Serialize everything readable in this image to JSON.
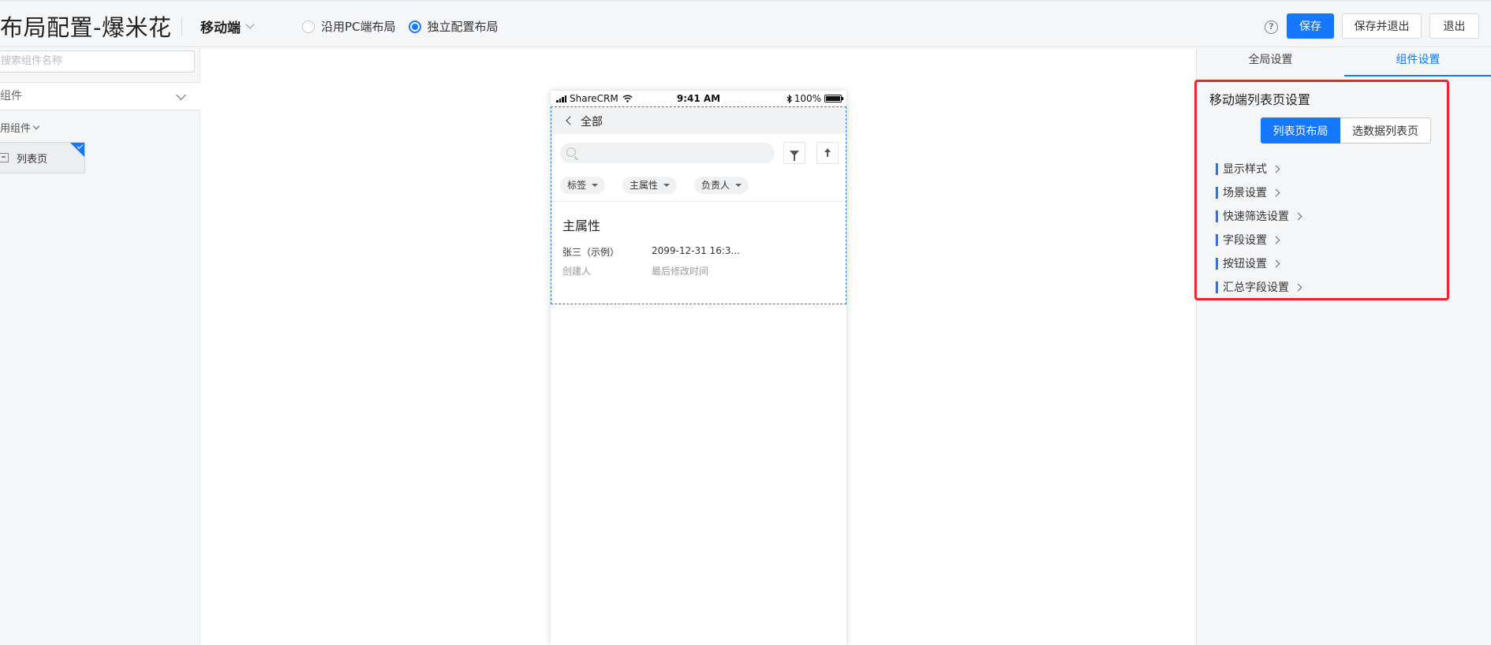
{
  "header": {
    "title": "布局配置-爆米花",
    "platform_label": "移动端",
    "layout_options": [
      {
        "label": "沿用PC端布局",
        "checked": false
      },
      {
        "label": "独立配置布局",
        "checked": true
      }
    ],
    "help_glyph": "?",
    "save_label": "保存",
    "save_exit_label": "保存并退出",
    "exit_label": "退出"
  },
  "left_panel": {
    "search_placeholder": "搜索组件名称",
    "group_label": "组件",
    "subgroup_label": "用组件",
    "component_card_label": "列表页"
  },
  "phone": {
    "carrier": "ShareCRM",
    "time": "9:41 AM",
    "battery": "100%",
    "nav_title": "全部",
    "chips": [
      "标签",
      "主属性",
      "负责人"
    ],
    "card": {
      "title": "主属性",
      "field_values": [
        "张三（示例）",
        "2099-12-31 16:3..."
      ],
      "field_labels": [
        "创建人",
        "最后修改时间"
      ]
    }
  },
  "right_panel": {
    "tabs": [
      "全局设置",
      "组件设置"
    ],
    "active_tab": 1,
    "section_title": "移动端列表页设置",
    "segment_active": "列表页布局",
    "segment_inactive": "选数据列表页",
    "settings": [
      "显示样式",
      "场景设置",
      "快速筛选设置",
      "字段设置",
      "按钮设置",
      "汇总字段设置"
    ]
  },
  "colors": {
    "primary": "#1677ff",
    "highlight_border": "#f5222d",
    "panel_bg": "#f5f6f8"
  }
}
